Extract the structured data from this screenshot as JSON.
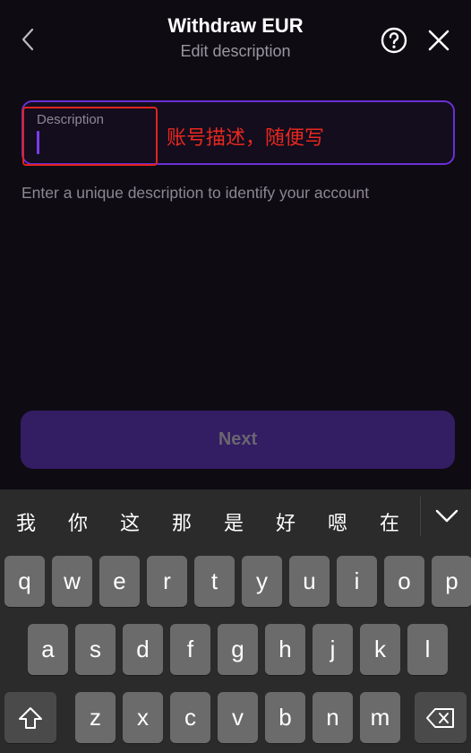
{
  "header": {
    "title": "Withdraw EUR",
    "subtitle": "Edit description",
    "back_icon": "chevron-left-icon",
    "help_icon": "question-circle-icon",
    "close_icon": "close-icon"
  },
  "form": {
    "description_label": "Description",
    "description_value": "",
    "helper_text": "Enter a unique description to identify your account",
    "annotation": "账号描述，随便写",
    "next_label": "Next"
  },
  "colors": {
    "accent": "#6a2fd6",
    "annotation": "#e8281f",
    "button_disabled": "#331d63"
  },
  "keyboard": {
    "candidates": [
      "我",
      "你",
      "这",
      "那",
      "是",
      "好",
      "嗯",
      "在"
    ],
    "row1": [
      "q",
      "w",
      "e",
      "r",
      "t",
      "y",
      "u",
      "i",
      "o",
      "p"
    ],
    "row2": [
      "a",
      "s",
      "d",
      "f",
      "g",
      "h",
      "j",
      "k",
      "l"
    ],
    "row3": [
      "z",
      "x",
      "c",
      "v",
      "b",
      "n",
      "m"
    ],
    "shift_icon": "shift-icon",
    "delete_icon": "backspace-icon",
    "expand_icon": "chevron-down-icon"
  }
}
